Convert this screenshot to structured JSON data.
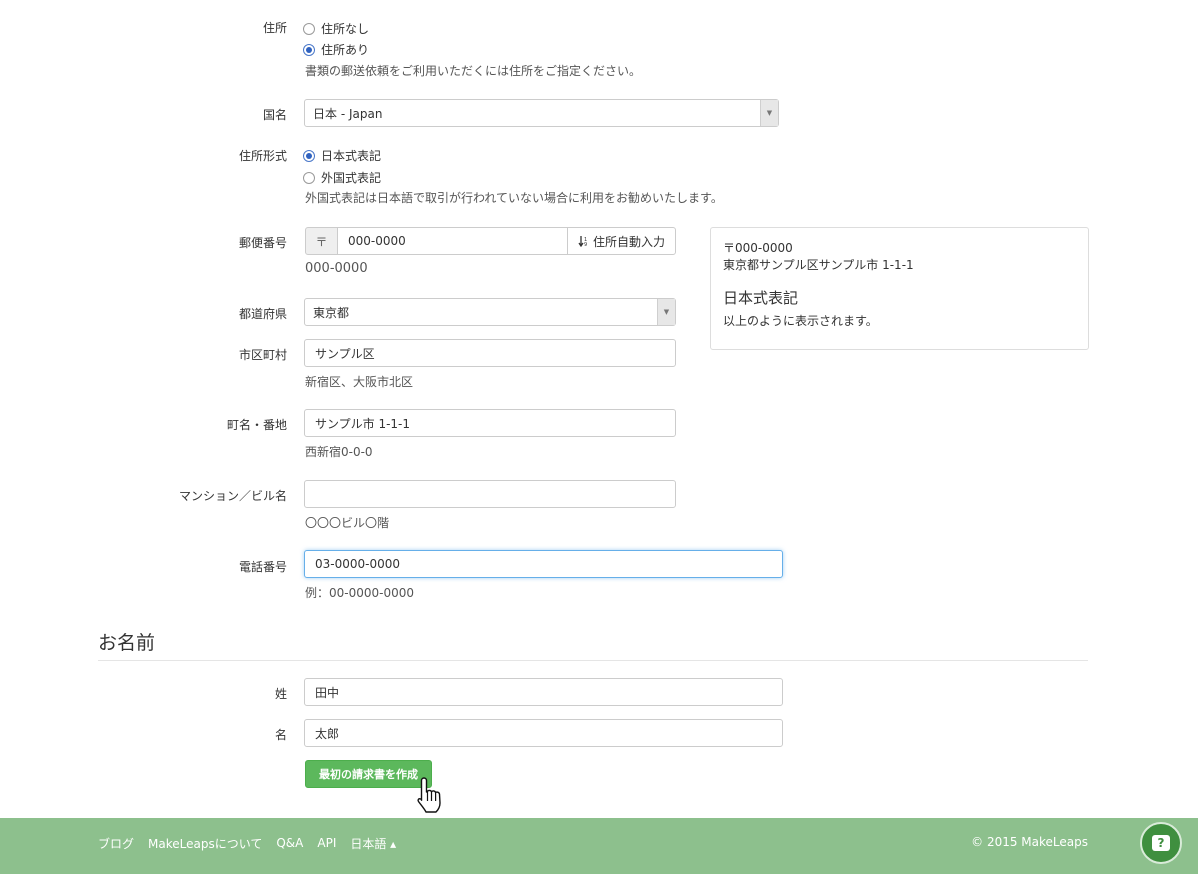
{
  "address": {
    "label": "住所",
    "options": [
      "住所なし",
      "住所あり"
    ],
    "selected_index": 1,
    "help": "書類の郵送依頼をご利用いただくには住所をご指定ください。"
  },
  "country": {
    "label": "国名",
    "value": "日本 - Japan"
  },
  "address_format": {
    "label": "住所形式",
    "options": [
      "日本式表記",
      "外国式表記"
    ],
    "selected_index": 0,
    "help": "外国式表記は日本語で取引が行われていない場合に利用をお勧めいたします。"
  },
  "postal": {
    "label": "郵便番号",
    "prefix": "〒",
    "value": "000-0000",
    "autofill_label": "住所自動入力",
    "help": "000-0000"
  },
  "prefecture": {
    "label": "都道府県",
    "value": "東京都"
  },
  "city": {
    "label": "市区町村",
    "value": "サンプル区",
    "help": "新宿区、大阪市北区"
  },
  "street": {
    "label": "町名・番地",
    "value": "サンプル市 1-1-1",
    "help": "西新宿0-0-0"
  },
  "building": {
    "label": "マンション／ビル名",
    "value": "",
    "help": "〇〇〇ビル〇階"
  },
  "phone": {
    "label": "電話番号",
    "value": "03-0000-0000",
    "help": "例：00-0000-0000"
  },
  "preview": {
    "postal_line": "〒000-0000",
    "address_line": "東京都サンプル区サンプル市 1-1-1",
    "format_title": "日本式表記",
    "note": "以上のように表示されます。"
  },
  "name_section": {
    "title": "お名前",
    "last_name_label": "姓",
    "last_name_value": "田中",
    "first_name_label": "名",
    "first_name_value": "太郎",
    "submit_label": "最初の請求書を作成"
  },
  "footer": {
    "links": [
      "ブログ",
      "MakeLeapsについて",
      "Q&A",
      "API",
      "日本語 ▴"
    ],
    "copyright": "© 2015 MakeLeaps"
  },
  "icons": {
    "sort_icon": "sort-icon",
    "help_icon": "help-icon",
    "cursor_icon": "hand-cursor-icon"
  },
  "colors": {
    "success": "#5cb85c",
    "footer_bg": "#8dc08d",
    "focus": "#66afe9",
    "fab": "#3f8f3f"
  }
}
